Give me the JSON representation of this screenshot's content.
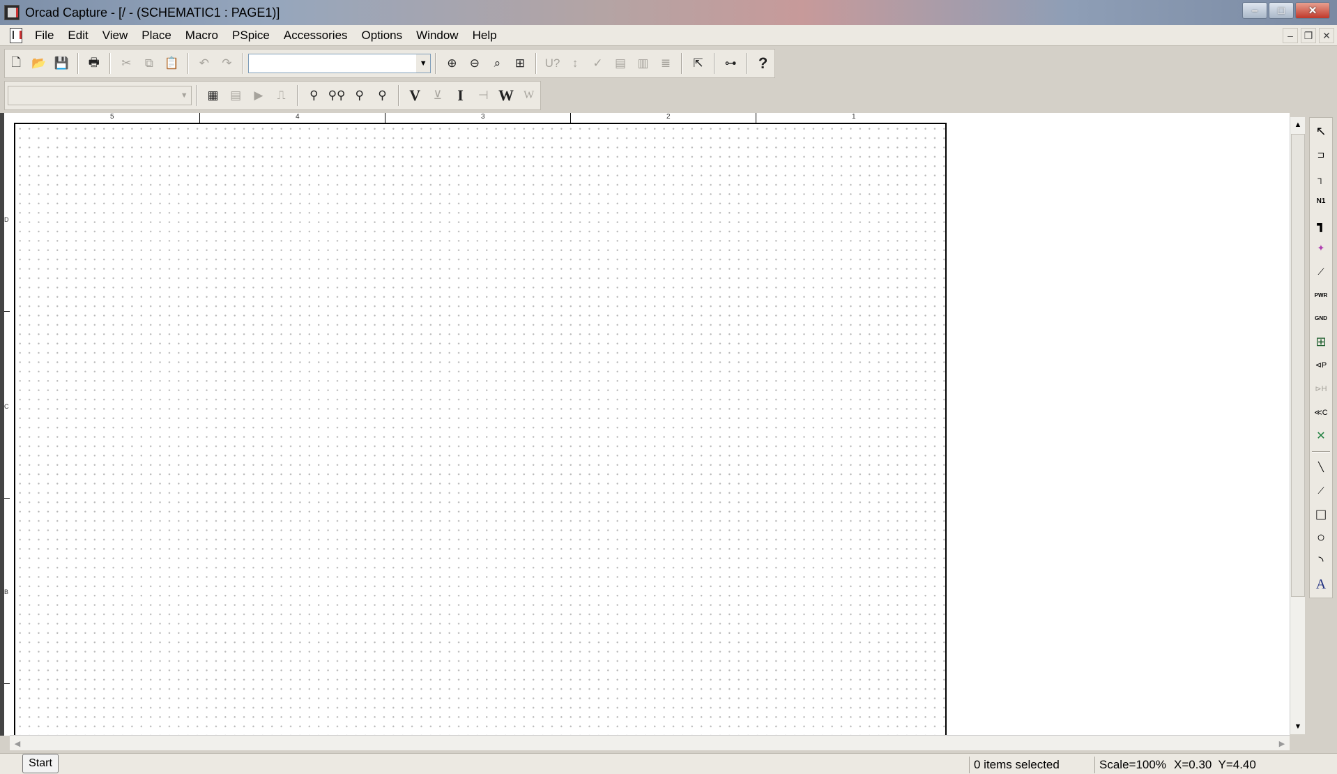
{
  "window": {
    "title": "Orcad Capture - [/ - (SCHEMATIC1 : PAGE1)]",
    "controls": {
      "minimize": "–",
      "maximize": "□",
      "close": "✕"
    }
  },
  "menubar": {
    "items": [
      "File",
      "Edit",
      "View",
      "Place",
      "Macro",
      "PSpice",
      "Accessories",
      "Options",
      "Window",
      "Help"
    ],
    "mdi_controls": {
      "minimize": "–",
      "restore": "❐",
      "close": "✕"
    }
  },
  "toolbar1": {
    "part_combo_value": "",
    "buttons": [
      {
        "name": "new-icon",
        "glyph": "🗋"
      },
      {
        "name": "open-icon",
        "glyph": "📂"
      },
      {
        "name": "save-icon",
        "glyph": "💾"
      },
      {
        "name": "print-icon",
        "glyph": "🖶"
      },
      {
        "name": "cut-icon",
        "glyph": "✂"
      },
      {
        "name": "copy-icon",
        "glyph": "⧉"
      },
      {
        "name": "paste-icon",
        "glyph": "📋"
      },
      {
        "name": "undo-icon",
        "glyph": "↶"
      },
      {
        "name": "redo-icon",
        "glyph": "↷"
      },
      {
        "name": "zoom-in-icon",
        "glyph": "⊕"
      },
      {
        "name": "zoom-out-icon",
        "glyph": "⊖"
      },
      {
        "name": "zoom-area-icon",
        "glyph": "⌕"
      },
      {
        "name": "zoom-all-icon",
        "glyph": "⊞"
      },
      {
        "name": "annotate-icon",
        "glyph": "U?"
      },
      {
        "name": "back-annotate-icon",
        "glyph": "↕"
      },
      {
        "name": "drc-icon",
        "glyph": "✓"
      },
      {
        "name": "netlist-icon",
        "glyph": "▤"
      },
      {
        "name": "cross-ref-icon",
        "glyph": "▥"
      },
      {
        "name": "bom-icon",
        "glyph": "≣"
      },
      {
        "name": "snap-grid-icon",
        "glyph": "⇱"
      },
      {
        "name": "project-manager-icon",
        "glyph": "⊶"
      },
      {
        "name": "help-icon",
        "glyph": "?"
      }
    ]
  },
  "toolbar2": {
    "profile_combo_value": "",
    "buttons": [
      {
        "name": "new-simulation-profile-icon",
        "glyph": "▦"
      },
      {
        "name": "edit-simulation-profile-icon",
        "glyph": "▤"
      },
      {
        "name": "run-icon",
        "glyph": "▶"
      },
      {
        "name": "view-results-icon",
        "glyph": "⎍"
      },
      {
        "name": "voltage-marker-icon",
        "glyph": "⚲"
      },
      {
        "name": "voltage-differential-marker-icon",
        "glyph": "⚲⚲"
      },
      {
        "name": "current-marker-icon",
        "glyph": "⚲"
      },
      {
        "name": "power-marker-icon",
        "glyph": "⚲"
      },
      {
        "name": "bias-voltage-icon",
        "glyph": "V"
      },
      {
        "name": "bias-voltage-pin-icon",
        "glyph": "⊻"
      },
      {
        "name": "bias-current-icon",
        "glyph": "I"
      },
      {
        "name": "bias-current-pin-icon",
        "glyph": "⊣"
      },
      {
        "name": "bias-power-icon",
        "glyph": "W"
      },
      {
        "name": "bias-power-pin-icon",
        "glyph": "W"
      }
    ]
  },
  "schematic": {
    "ruler_top": [
      "5",
      "4",
      "3",
      "2",
      "1"
    ],
    "ruler_left": [
      "D",
      "C",
      "B"
    ]
  },
  "palette": {
    "tools": [
      {
        "name": "select-icon",
        "glyph": "↖"
      },
      {
        "name": "place-part-icon",
        "glyph": "⊐"
      },
      {
        "name": "place-wire-icon",
        "glyph": "┐"
      },
      {
        "name": "place-net-alias-icon",
        "glyph": "N1"
      },
      {
        "name": "place-bus-icon",
        "glyph": "┓"
      },
      {
        "name": "place-junction-icon",
        "glyph": "✦"
      },
      {
        "name": "place-bus-entry-icon",
        "glyph": "⟋"
      },
      {
        "name": "place-power-icon",
        "glyph": "PWR"
      },
      {
        "name": "place-ground-icon",
        "glyph": "GND"
      },
      {
        "name": "place-hierarchical-block-icon",
        "glyph": "⊞"
      },
      {
        "name": "place-hierarchical-port-icon",
        "glyph": "⊲P"
      },
      {
        "name": "place-hierarchical-pin-icon",
        "glyph": "⊳H"
      },
      {
        "name": "place-off-page-connector-icon",
        "glyph": "≪C"
      },
      {
        "name": "place-no-connect-icon",
        "glyph": "✕"
      },
      {
        "name": "place-line-icon",
        "glyph": "╲"
      },
      {
        "name": "place-polyline-icon",
        "glyph": "⟋"
      },
      {
        "name": "place-rectangle-icon",
        "glyph": "□"
      },
      {
        "name": "place-ellipse-icon",
        "glyph": "○"
      },
      {
        "name": "place-arc-icon",
        "glyph": "◝"
      },
      {
        "name": "place-text-icon",
        "glyph": "A"
      }
    ]
  },
  "statusbar": {
    "start_label": "Start",
    "selection": "0 items selected",
    "scale": "Scale=100%",
    "coords": "X=0.30  Y=4.40"
  }
}
